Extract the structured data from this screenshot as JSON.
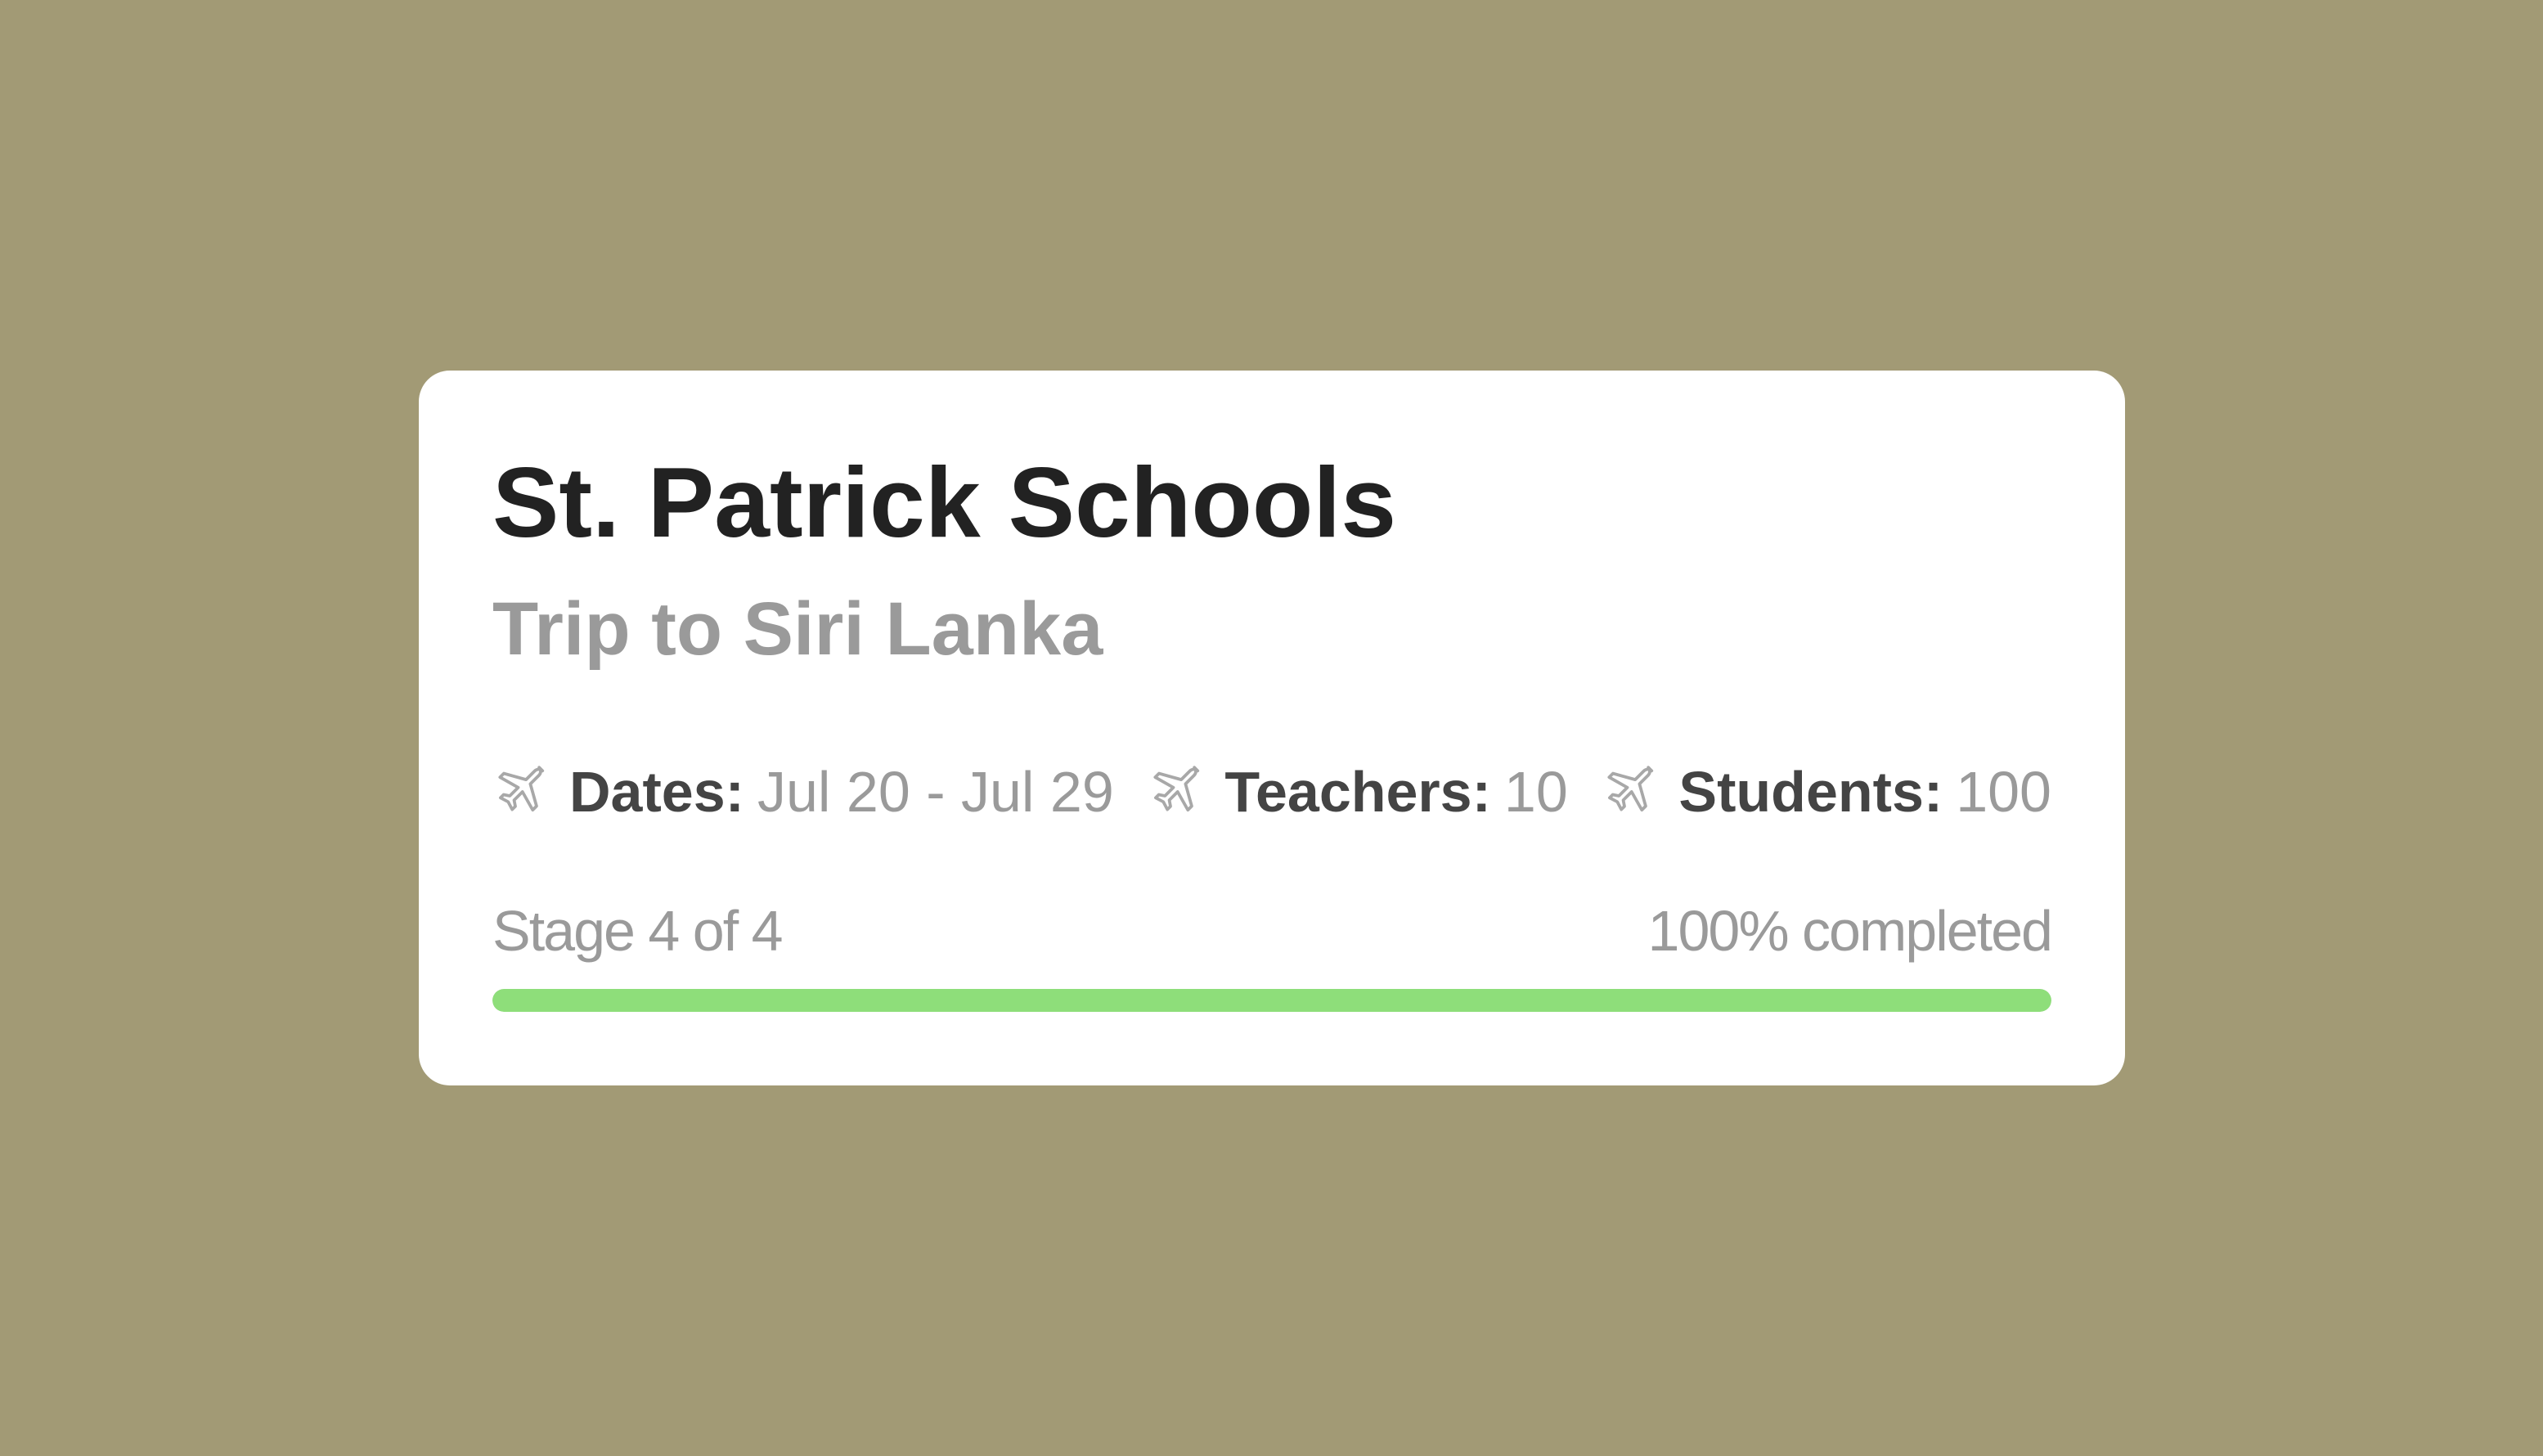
{
  "card": {
    "title": "St. Patrick Schools",
    "subtitle": "Trip to Siri Lanka",
    "meta": [
      {
        "icon": "airplane-icon",
        "label": "Dates:",
        "value": "Jul 20 - Jul 29"
      },
      {
        "icon": "airplane-icon",
        "label": "Teachers:",
        "value": "10"
      },
      {
        "icon": "airplane-icon",
        "label": "Students:",
        "value": "100"
      }
    ],
    "progress": {
      "stage_text": "Stage 4 of 4",
      "completed_text": "100% completed",
      "percent": 100
    }
  },
  "colors": {
    "background": "#a29a75",
    "card": "#ffffff",
    "title": "#222222",
    "muted": "#9a9a9a",
    "progress_fill": "#8ede7a"
  }
}
